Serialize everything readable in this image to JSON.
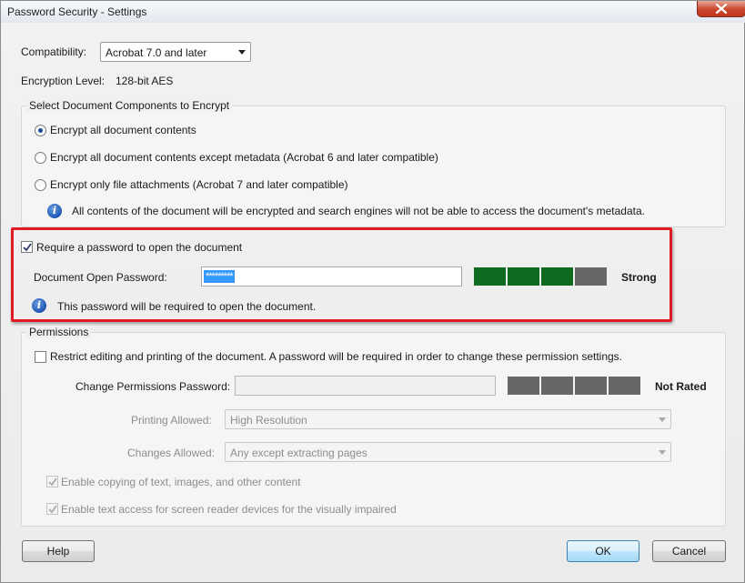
{
  "window": {
    "title": "Password Security - Settings"
  },
  "compatibility": {
    "label": "Compatibility:",
    "value": "Acrobat 7.0 and later"
  },
  "encryption": {
    "label": "Encryption  Level:",
    "value": "128-bit AES"
  },
  "components": {
    "title": "Select Document Components to Encrypt",
    "options": [
      {
        "label": "Encrypt all document contents",
        "selected": true
      },
      {
        "label": "Encrypt all document contents except metadata (Acrobat 6 and later compatible)",
        "selected": false
      },
      {
        "label": "Encrypt only file attachments (Acrobat 7 and later compatible)",
        "selected": false
      }
    ],
    "info": "All contents of the document will be encrypted and search engines will not be able to access the document's metadata."
  },
  "open_password": {
    "checkbox_label": "Require a password to open the document",
    "checked": true,
    "field_label": "Document Open Password:",
    "masked_value": "*********",
    "strength": "Strong",
    "strength_segments_filled": 3,
    "strength_segments_total": 4,
    "info": "This password will be required to open the document."
  },
  "permissions": {
    "title": "Permissions",
    "restrict_label": "Restrict editing and printing of the document. A password will be required in order to change these permission settings.",
    "restrict_checked": false,
    "password_label": "Change Permissions Password:",
    "strength": "Not Rated",
    "strength_segments_filled": 0,
    "strength_segments_total": 4,
    "printing_label": "Printing Allowed:",
    "printing_value": "High Resolution",
    "changes_label": "Changes Allowed:",
    "changes_value": "Any except extracting pages",
    "copy_label": "Enable copying of text, images, and other content",
    "copy_checked": true,
    "reader_label": "Enable text access for screen reader devices for the visually impaired",
    "reader_checked": true
  },
  "buttons": {
    "help": "Help",
    "ok": "OK",
    "cancel": "Cancel"
  },
  "colors": {
    "meter_filled": "#0d6b1f",
    "meter_empty": "#676767",
    "highlight": "#e01b24"
  }
}
